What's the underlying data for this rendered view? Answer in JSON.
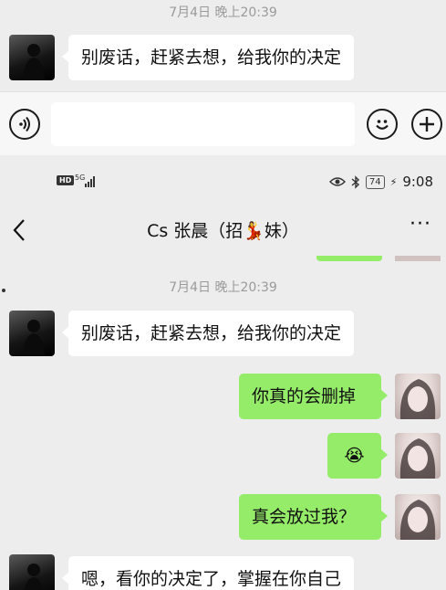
{
  "top_chat": {
    "timestamp": "7月4日 晚上20:39",
    "message": "别废话，赶紧去想，给我你的决定"
  },
  "input_bar": {
    "voice_icon": "voice-icon",
    "emoji_icon": "emoji-icon",
    "add_icon": "add-icon",
    "value": ""
  },
  "status_bar": {
    "hd": "HD",
    "network": "5G",
    "battery": "74",
    "time": "9:08"
  },
  "header": {
    "back": "‹",
    "title": "Cs 张晨（招💃妹）",
    "more": "···"
  },
  "chat": {
    "timestamp": "7月4日 晚上20:39",
    "messages": [
      {
        "side": "left",
        "text": "别废话，赶紧去想，给我你的决定"
      },
      {
        "side": "right",
        "text": "你真的会删掉"
      },
      {
        "side": "right",
        "text": "😭"
      },
      {
        "side": "right",
        "text": "真会放过我？"
      },
      {
        "side": "left",
        "text": "嗯，看你的决定了，掌握在你自己"
      }
    ]
  },
  "colors": {
    "background": "#ededed",
    "bubble_self": "#95ec69",
    "bubble_other": "#ffffff"
  }
}
